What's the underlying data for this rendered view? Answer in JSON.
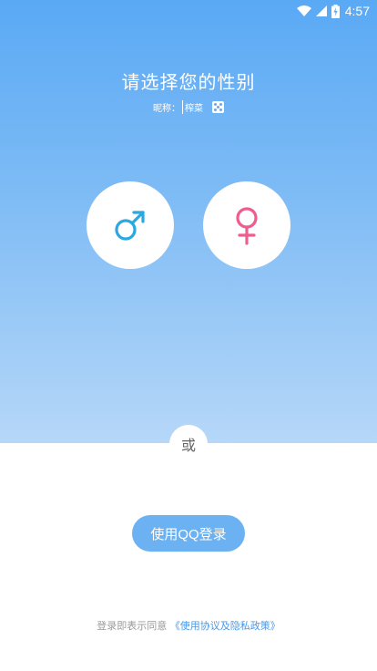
{
  "status_bar": {
    "time": "4:57",
    "icons": [
      "wifi-icon",
      "cell-signal-icon",
      "battery-icon"
    ]
  },
  "title": "请选择您的性别",
  "nickname": {
    "label": "昵称：",
    "value": "榨菜",
    "random_icon": "dice-icon"
  },
  "gender": {
    "male_icon": "male-symbol-icon",
    "female_icon": "female-symbol-icon"
  },
  "divider_text": "或",
  "qq_login_label": "使用QQ登录",
  "agreement": {
    "prefix": "登录即表示同意",
    "link": "《使用协议及隐私政策》"
  },
  "colors": {
    "gradient_top": "#5aa9f5",
    "gradient_bottom": "#b6d7f8",
    "male": "#2aa8e3",
    "female": "#ef5d8e",
    "button": "#6cb2f2",
    "link": "#4a98e6"
  }
}
